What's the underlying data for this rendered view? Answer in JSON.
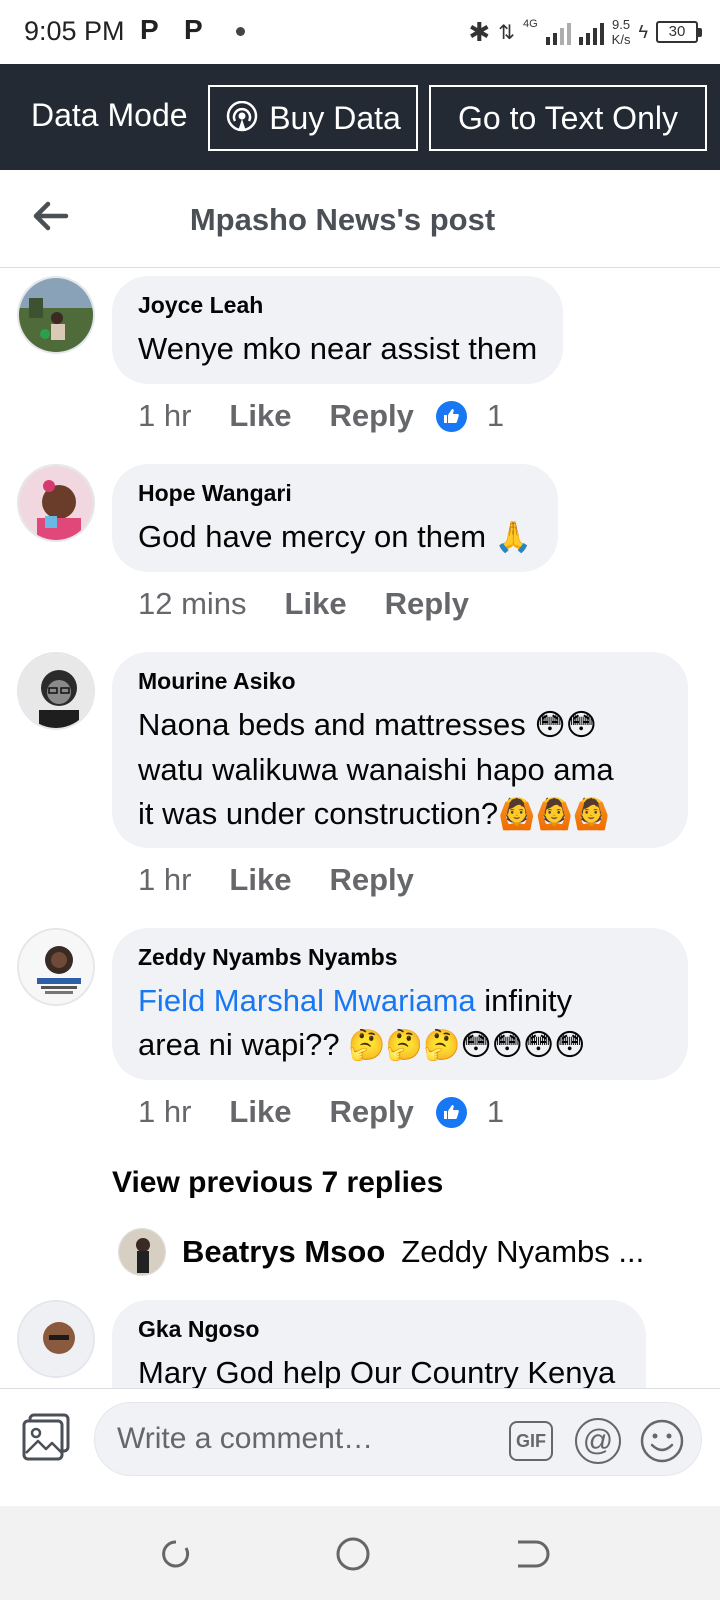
{
  "status_bar": {
    "time": "9:05 PM",
    "notif_icons": [
      "P",
      "P"
    ],
    "network_type": "4G",
    "speed_value": "9.5",
    "speed_unit": "K/s",
    "battery": "30"
  },
  "data_bar": {
    "mode_label": "Data Mode",
    "buy_data_label": "Buy Data",
    "text_only_label": "Go to Text Only"
  },
  "header": {
    "title": "Mpasho News's post"
  },
  "comments": [
    {
      "author": "Joyce Leah",
      "text": "Wenye mko near assist  them",
      "time": "1 hr",
      "like": "Like",
      "reply": "Reply",
      "reaction_count": "1"
    },
    {
      "author": "Hope Wangari",
      "text": "God have mercy on them",
      "emoji": "🙏",
      "time": "12 mins",
      "like": "Like",
      "reply": "Reply"
    },
    {
      "author": "Mourine Asiko",
      "line1": "Naona beds and mattresses",
      "line1_emoji": "😳😳",
      "line2": "watu walikuwa wanaishi hapo ama",
      "line3": "it was under construction?",
      "line3_emoji": "🙆🙆🙆",
      "time": "1 hr",
      "like": "Like",
      "reply": "Reply"
    },
    {
      "author": "Zeddy Nyambs Nyambs",
      "mention": "Field Marshal Mwariama",
      "text_after_mention": " infinity",
      "line2": "area ni wapi??",
      "line2_emoji": "🤔🤔🤔😳😳😳😳",
      "time": "1 hr",
      "like": "Like",
      "reply": "Reply",
      "reaction_count": "1"
    }
  ],
  "replies": {
    "view_previous": "View previous 7 replies",
    "latest_author": "Beatrys Msoo",
    "latest_preview": "Zeddy Nyambs ..."
  },
  "partial_comment": {
    "author": "Gka Ngoso",
    "text": "Mary God help Our Country Kenya"
  },
  "composer": {
    "placeholder": "Write a comment…",
    "gif_label": "GIF",
    "at_label": "@"
  },
  "colors": {
    "accent": "#1877f2",
    "data_bar_bg": "#232a33",
    "bubble_bg": "#f0f2f5",
    "secondary_text": "#65676b"
  },
  "icons": {
    "back": "back-arrow-icon",
    "buy_data": "broadcast-signal-icon",
    "photo": "photo-icon",
    "smile": "smile-icon",
    "like_badge": "thumbs-up-icon"
  }
}
